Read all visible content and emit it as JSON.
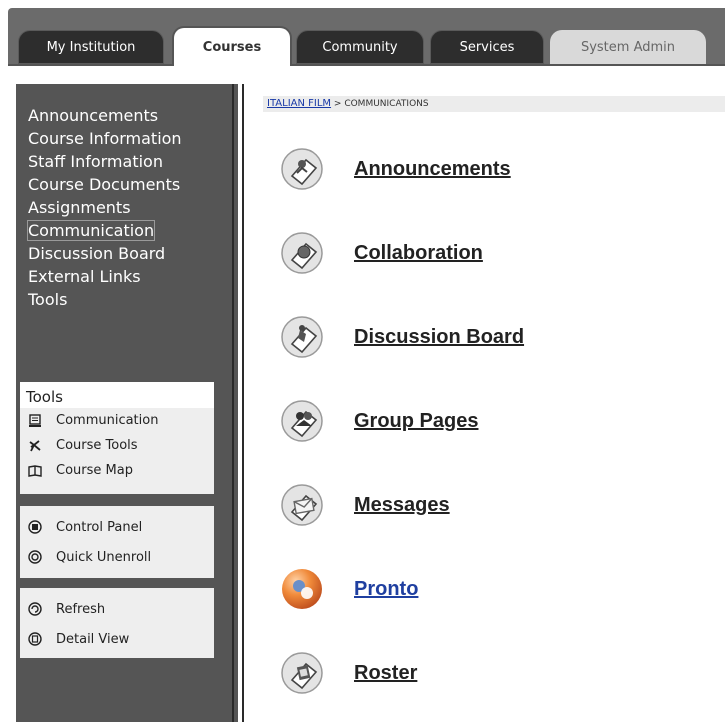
{
  "tabs": [
    {
      "label": "My Institution",
      "state": "dark"
    },
    {
      "label": "Courses",
      "state": "active"
    },
    {
      "label": "Community",
      "state": "dark"
    },
    {
      "label": "Services",
      "state": "dark"
    },
    {
      "label": "System Admin",
      "state": "light"
    }
  ],
  "sidebar": {
    "items": [
      {
        "label": "Announcements"
      },
      {
        "label": "Course Information"
      },
      {
        "label": "Staff Information"
      },
      {
        "label": "Course Documents"
      },
      {
        "label": "Assignments"
      },
      {
        "label": "Communication",
        "selected": true
      },
      {
        "label": "Discussion Board"
      },
      {
        "label": "External Links"
      },
      {
        "label": "Tools"
      }
    ],
    "tools_box": {
      "title": "Tools",
      "items": [
        {
          "label": "Communication",
          "icon": "communication-icon"
        },
        {
          "label": "Course Tools",
          "icon": "course-tools-icon"
        },
        {
          "label": "Course Map",
          "icon": "course-map-icon"
        }
      ]
    },
    "control_box": {
      "items": [
        {
          "label": "Control Panel",
          "icon": "control-panel-icon"
        },
        {
          "label": "Quick Unenroll",
          "icon": "quick-unenroll-icon"
        }
      ]
    },
    "refresh_box": {
      "items": [
        {
          "label": "Refresh",
          "icon": "refresh-icon"
        },
        {
          "label": "Detail View",
          "icon": "detail-view-icon"
        }
      ]
    }
  },
  "breadcrumb": {
    "course": "ITALIAN FILM",
    "separator": " > ",
    "page": "COMMUNICATIONS"
  },
  "tools": [
    {
      "label": "Announcements",
      "icon": "announcements-icon"
    },
    {
      "label": "Collaboration",
      "icon": "collaboration-icon"
    },
    {
      "label": "Discussion Board",
      "icon": "discussion-board-icon"
    },
    {
      "label": "Group Pages",
      "icon": "group-pages-icon"
    },
    {
      "label": "Messages",
      "icon": "messages-icon"
    },
    {
      "label": "Pronto",
      "icon": "pronto-icon",
      "color": "#1f3fa0"
    },
    {
      "label": "Roster",
      "icon": "roster-icon"
    }
  ],
  "colors": {
    "sidebar_bg": "#555555",
    "tab_dark": "#2d2d2d",
    "link_blue": "#1f3fa0",
    "pronto_orange": "#e8692a"
  }
}
